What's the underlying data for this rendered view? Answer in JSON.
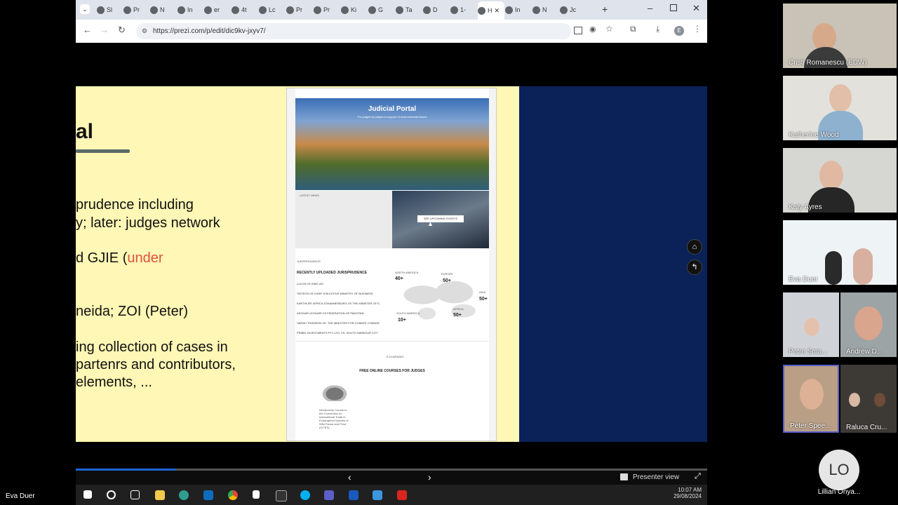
{
  "browser": {
    "tabs": [
      {
        "label": "Sl",
        "icon": "play-icon"
      },
      {
        "label": "Pr",
        "icon": "play-icon"
      },
      {
        "label": "N",
        "icon": "globe-icon"
      },
      {
        "label": "In",
        "icon": "github-icon"
      },
      {
        "label": "er",
        "icon": "globe-icon"
      },
      {
        "label": "4t",
        "icon": "globe-icon"
      },
      {
        "label": "Lc",
        "icon": "globe-icon"
      },
      {
        "label": "Pr",
        "icon": "globe-icon"
      },
      {
        "label": "Pr",
        "icon": "pencil-icon"
      },
      {
        "label": "Ki",
        "icon": "globe-icon"
      },
      {
        "label": "G",
        "icon": "globe-icon"
      },
      {
        "label": "Ta",
        "icon": "globe-icon"
      },
      {
        "label": "D",
        "icon": "globe-icon"
      },
      {
        "label": "1-",
        "icon": "globe-icon"
      },
      {
        "label": "H",
        "icon": "globe-icon",
        "active": true
      },
      {
        "label": "In",
        "icon": "play-icon"
      },
      {
        "label": "N",
        "icon": "github-icon"
      },
      {
        "label": "Jc",
        "icon": "teams-icon"
      }
    ],
    "url": "https://prezi.com/p/edit/dic9kv-jxyv7/",
    "profile_initial": "E"
  },
  "slide": {
    "title_fragment": "al",
    "lines": [
      "prudence including",
      "y; later: judges network",
      "d GJIE (",
      "neida; ZOI (Peter)",
      "ing collection of cases in",
      " partenrs and contributors,",
      "elements, ..."
    ],
    "highlight": "under"
  },
  "portal": {
    "title": "Judicial Portal",
    "subtitle": "For judges by judges in support of environmental issues",
    "latest_news": "LATEST NEWS",
    "events_button": "SEE UPCOMING EVENTS",
    "section_label": "JURISPRUDENCE",
    "recent_heading": "RECENTLY UPLOADED JURISPRUDENCE",
    "cases": [
      "LULIYA VS KWIC AG",
      "TEITEITA VS CHIEF EXECUTIVE MINISTRY OF BUSINESS",
      "EARTHLIFE AFRICA JOHANNESBURG VS THE MINISTER OF E...",
      "ASGHAR LEGHARI VS FEDERATION OF PAKISTAN",
      "SARAH THOMSON VS. THE MINISTER FOR CLIMATE CHANGE",
      "PRIBEL INVESTMENTS PTY LTD. VS. SOUTH HARBOUR CITY"
    ],
    "regions": [
      {
        "name": "NORTH AMERICA",
        "count": "40+"
      },
      {
        "name": "EUROPE",
        "count": "50+"
      },
      {
        "name": "ASIA",
        "count": "50+"
      },
      {
        "name": "SOUTH AMERICA",
        "count": "10+"
      },
      {
        "name": "AFRICA",
        "count": "50+"
      }
    ],
    "elearning_label": "E-LEARNING",
    "courses_heading": "FREE ONLINE COURSES FOR JUDGES",
    "course_caption": "Introductory Course to the Convention on International Trade in Endangered Species of Wild Fauna and Flora (CITES)"
  },
  "controls": {
    "presenter_view": "Presenter view"
  },
  "taskbar": {
    "time": "10:07 AM",
    "date": "29/08/2024"
  },
  "participants": [
    {
      "name": "Cristi Romanescu (EDW)"
    },
    {
      "name": "Katherine Wood"
    },
    {
      "name": "Katy Ayres"
    },
    {
      "name": "Eva Duer"
    },
    {
      "name": "Petre Sma..."
    },
    {
      "name": "Andrew D..."
    },
    {
      "name": "Peter Spee..."
    },
    {
      "name": "Raluca Cru..."
    },
    {
      "name": "Lillian Onya...",
      "initials": "LO"
    }
  ],
  "self_label": "Eva Duer"
}
